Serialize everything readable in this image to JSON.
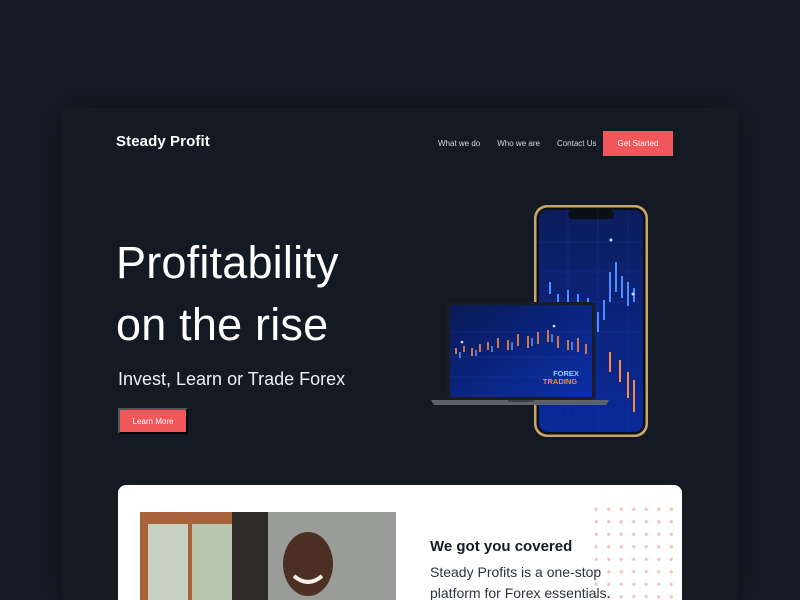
{
  "header": {
    "brand": "Steady Profit",
    "nav": [
      "What we do",
      "Who we are",
      "Contact Us"
    ],
    "cta": "Get Started"
  },
  "hero": {
    "title_line1": "Profitability",
    "title_line2": "on the rise",
    "subtitle": "Invest, Learn or Trade Forex",
    "button": "Learn More",
    "screen_text_line1": "FOREX",
    "screen_text_line2": "TRADING"
  },
  "feature": {
    "title": "We got you covered",
    "text": "Steady Profits is a one-stop platform for Forex essentials."
  },
  "colors": {
    "background": "#141b26",
    "accent": "#f0565a"
  }
}
